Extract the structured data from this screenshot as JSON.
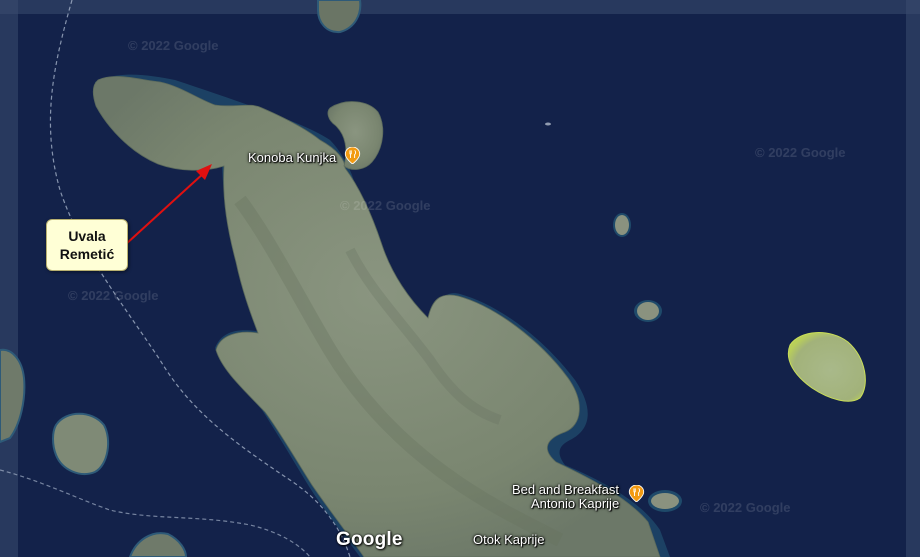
{
  "map": {
    "type": "satellite",
    "water_color": "#13224a",
    "land_color": "#7f8c78",
    "border_line": "dashed"
  },
  "labels": {
    "konoba": "Konoba Kunjka",
    "bnb_line1": "Bed and Breakfast",
    "bnb_line2": "Antonio Kaprije",
    "otok": "Otok Kaprije"
  },
  "callout": {
    "line1": "Uvala",
    "line2": "Remetić",
    "arrow_color": "#e01010"
  },
  "branding": {
    "google_logo": "Google",
    "watermark": "© 2022 Google"
  },
  "icons": {
    "poi": "restaurant-pin-icon"
  }
}
